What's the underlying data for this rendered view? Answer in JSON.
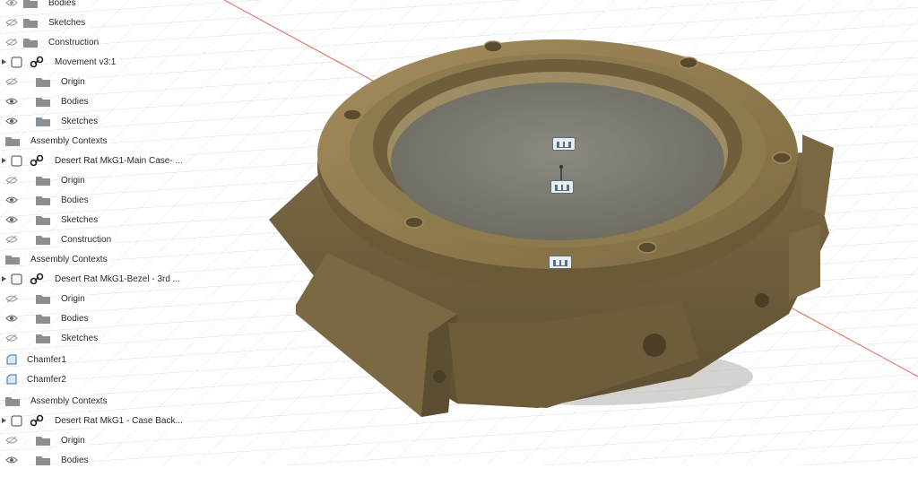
{
  "browser": {
    "items": [
      {
        "label": "Bodies"
      },
      {
        "label": "Sketches"
      },
      {
        "label": "Construction"
      },
      {
        "label": "Movement v3:1"
      },
      {
        "label": "Origin"
      },
      {
        "label": "Bodies"
      },
      {
        "label": "Sketches"
      },
      {
        "label": "Assembly Contexts"
      },
      {
        "label": "Desert Rat MkG1-Main Case- ..."
      },
      {
        "label": "Origin"
      },
      {
        "label": "Bodies"
      },
      {
        "label": "Sketches"
      },
      {
        "label": "Construction"
      },
      {
        "label": "Assembly Contexts"
      },
      {
        "label": "Desert Rat MkG1-Bezel - 3rd ..."
      },
      {
        "label": "Origin"
      },
      {
        "label": "Bodies"
      },
      {
        "label": "Sketches"
      },
      {
        "label": "Chamfer1"
      },
      {
        "label": "Chamfer2"
      },
      {
        "label": "Assembly Contexts"
      },
      {
        "label": "Desert Rat MkG1 - Case Back..."
      },
      {
        "label": "Origin"
      },
      {
        "label": "Bodies"
      }
    ]
  },
  "viewport": {
    "background": "#ffffff",
    "grid_color": "#d9d9d9",
    "x_axis_color": "#e06b5a",
    "model_color": "#8a744a"
  }
}
